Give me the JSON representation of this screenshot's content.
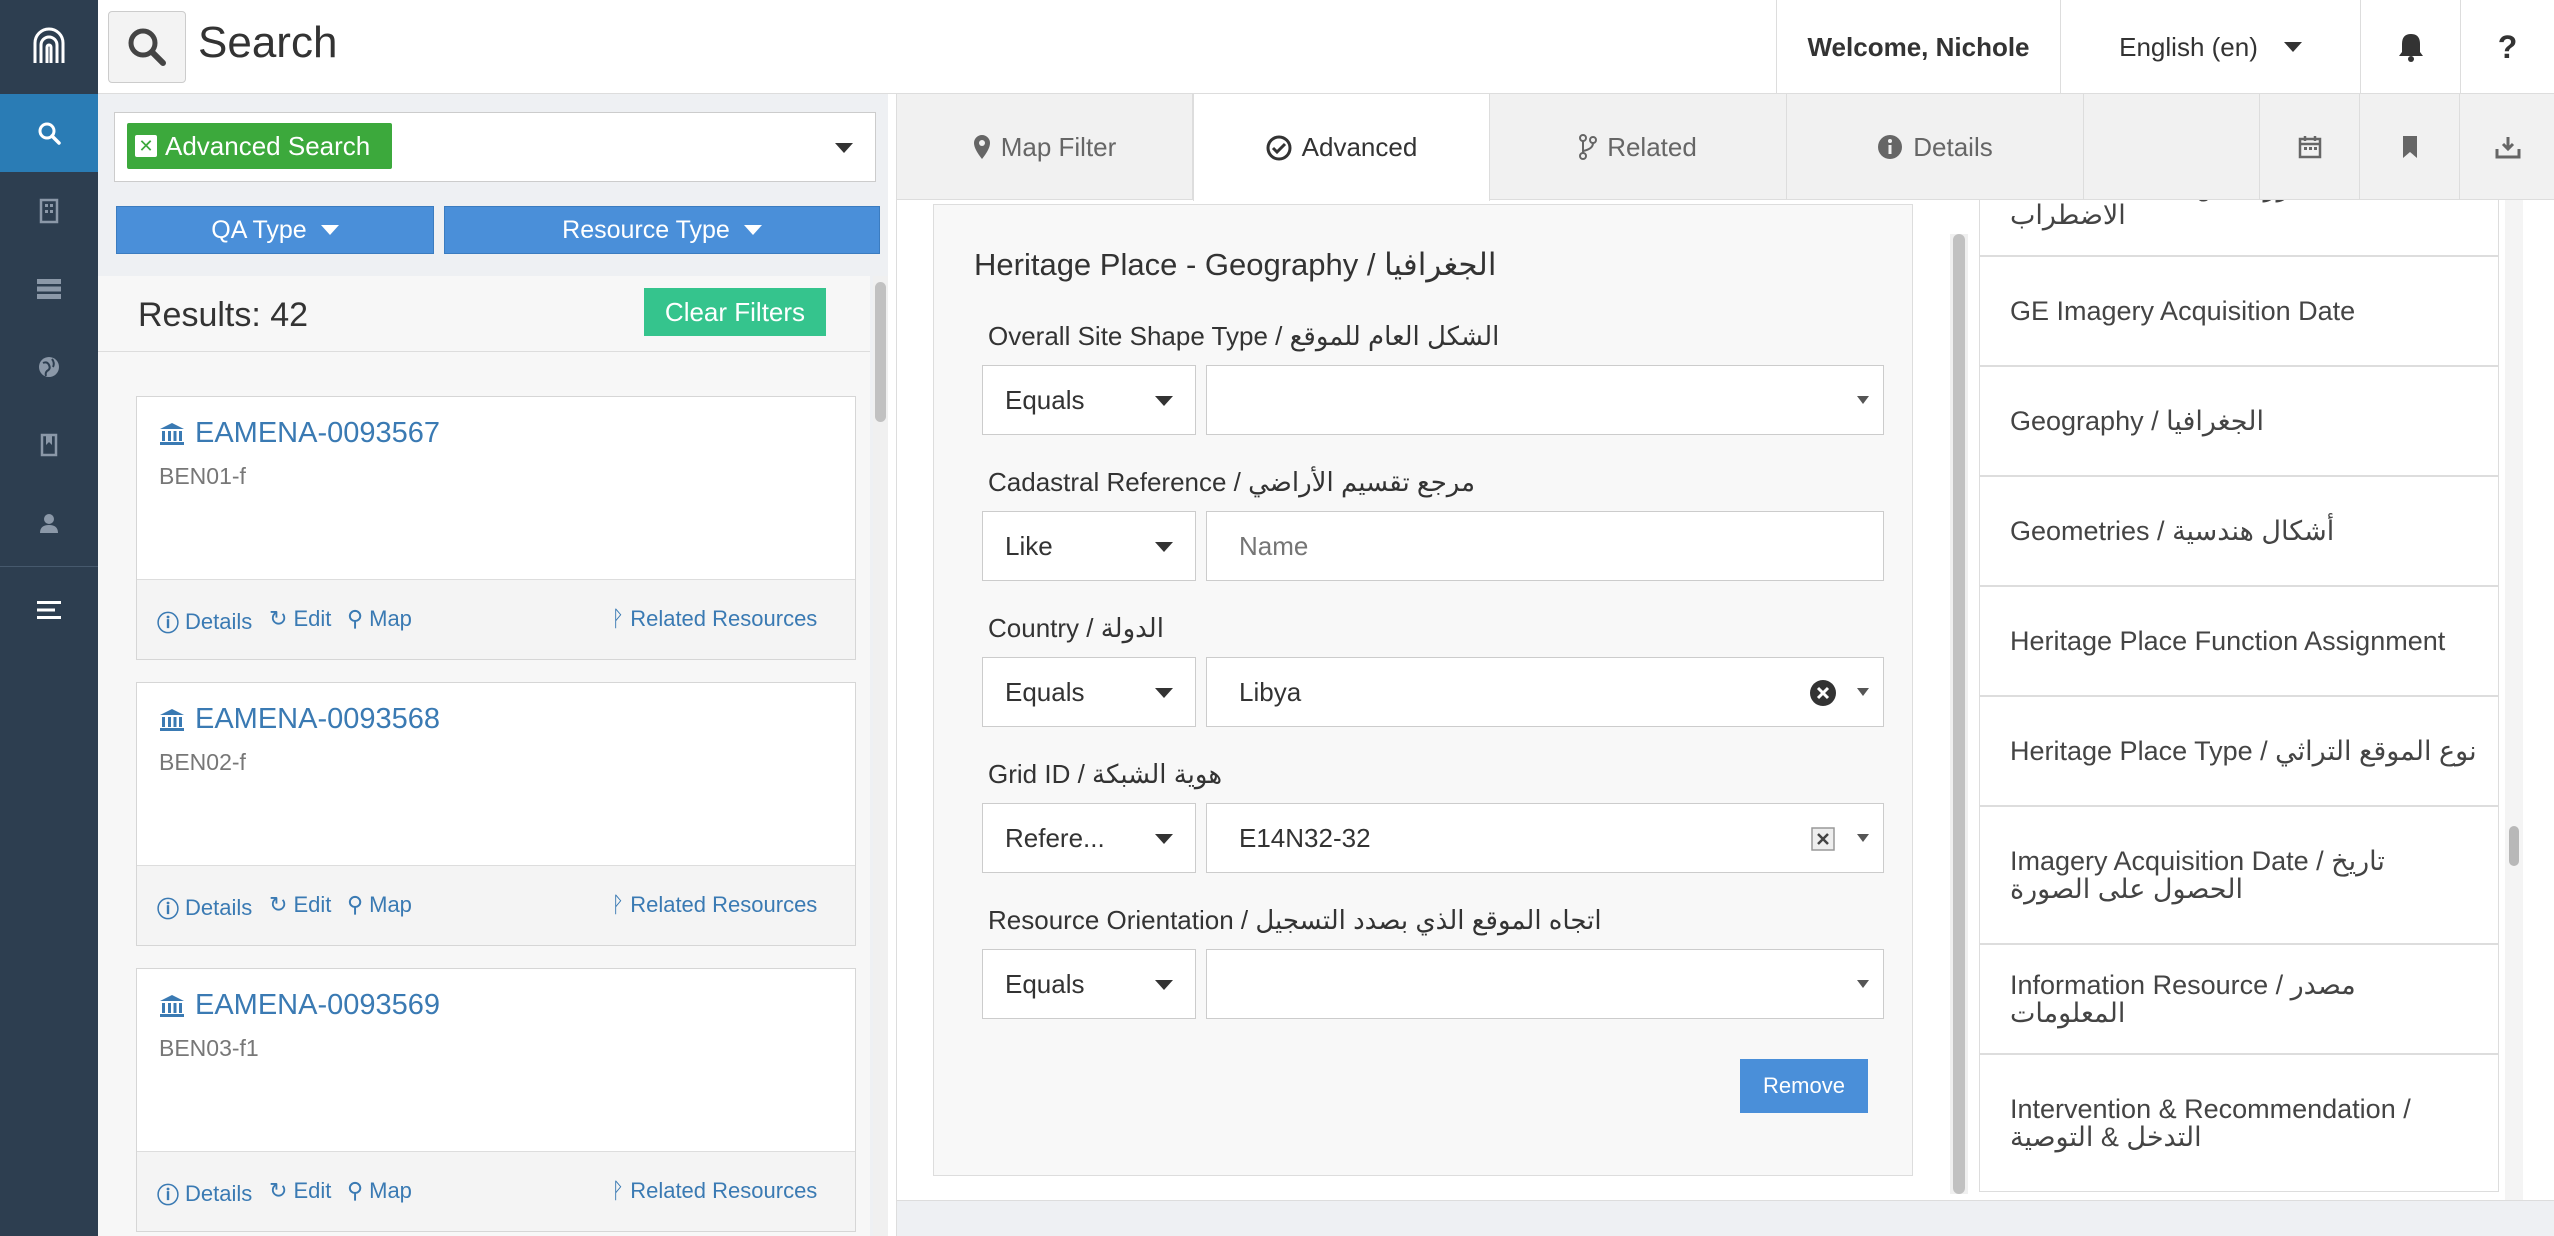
{
  "header": {
    "title": "Search",
    "welcome": "Welcome, Nichole",
    "language": "English (en)",
    "help": "?"
  },
  "search": {
    "chip_label": "Advanced Search",
    "filter_buttons": [
      "QA Type",
      "Resource Type"
    ],
    "results_label": "Results: 42",
    "clear_filters": "Clear Filters"
  },
  "results": [
    {
      "id": "EAMENA-0093567",
      "sub": "BEN01-f"
    },
    {
      "id": "EAMENA-0093568",
      "sub": "BEN02-f"
    },
    {
      "id": "EAMENA-0093569",
      "sub": "BEN03-f1"
    }
  ],
  "card_actions": {
    "details": "Details",
    "edit": "Edit",
    "map": "Map",
    "related": "Related Resources"
  },
  "tabs": [
    "Map Filter",
    "Advanced",
    "Related",
    "Details"
  ],
  "form": {
    "title": "Heritage Place - Geography / الجغرافيا",
    "fields": [
      {
        "label": "Overall Site Shape Type / الشكل العام للموقع",
        "op": "Equals",
        "value": ""
      },
      {
        "label": "Cadastral Reference / مرجع تقسيم الأراضي",
        "op": "Like",
        "value": "",
        "placeholder": "Name"
      },
      {
        "label": "Country / الدولة",
        "op": "Equals",
        "value": "Libya"
      },
      {
        "label": "Grid ID / هوية الشبكة",
        "op": "Refere...",
        "value": "E14N32-32"
      },
      {
        "label": "Resource Orientation / اتجاه الموقع الذي بصدد التسجيل",
        "op": "Equals",
        "value": ""
      }
    ],
    "remove": "Remove"
  },
  "cards_list": [
    "Extent of Damage / مدى الضرر / الاضطراب",
    "GE Imagery Acquisition Date",
    "Geography / الجغرافيا",
    "Geometries / أشكال هندسية",
    "Heritage Place Function Assignment",
    "Heritage Place Type / نوع الموقع التراثي",
    "Imagery Acquisition Date / تاريخ الحصول على الصورة",
    "Information Resource / مصدر المعلومات",
    "Intervention & Recommendation / التدخل & التوصية"
  ],
  "colors": {
    "nav": "#2d3e50",
    "nav_active": "#2a7cb5",
    "chip": "#3ca93c",
    "clear": "#35c48d",
    "primary": "#4a8fd9",
    "link": "#3a7ab3"
  },
  "icons": [
    "app-logo-icon",
    "search-icon",
    "building-icon",
    "list-icon",
    "globe-icon",
    "bookmark-icon",
    "user-icon",
    "menu-icon",
    "bell-icon",
    "calendar-icon",
    "bookmark-tab-icon",
    "download-icon"
  ]
}
